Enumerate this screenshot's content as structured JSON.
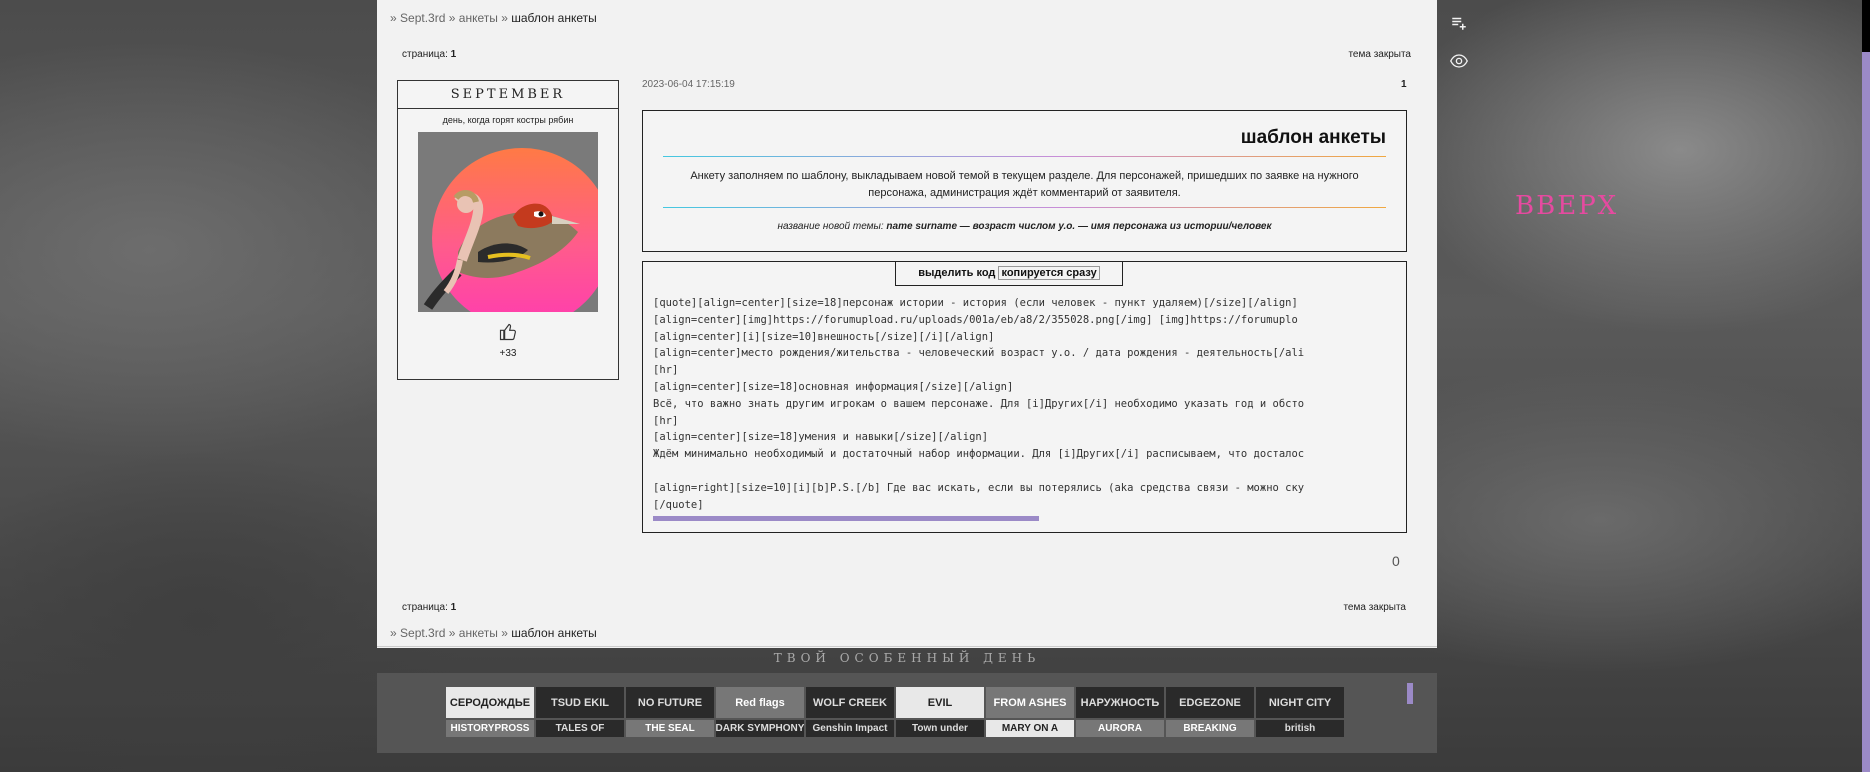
{
  "breadcrumb": {
    "sep": "»",
    "items": [
      "Sept.3rd",
      "анкеты",
      "шаблон анкеты"
    ]
  },
  "pagination": {
    "label": "страница:",
    "page": "1"
  },
  "topic_closed": "тема закрыта",
  "profile": {
    "logo": "SEPTEMBER",
    "status": "день, когда горят костры рябин",
    "likes": "+33"
  },
  "post": {
    "date": "2023-06-04 17:15:19",
    "number": "1",
    "title": "шаблон анкеты",
    "intro": "Анкету заполняем по шаблону, выкладываем новой темой в текущем разделе. Для персонажей, пришедших по заявке на нужного персонажа, администрация ждёт комментарий от заявителя.",
    "topic_note_prefix": "название новой темы:",
    "topic_note_bold": "name surname — возраст числом у.о. — имя персонажа из истории/человек"
  },
  "code_box": {
    "select_label": "выделить код",
    "copy_label": "копируется сразу",
    "lines": [
      "[quote][align=center][size=18]персонаж истории - история (если человек - пункт удаляем)[/size][/align]",
      "[align=center][img]https://forumupload.ru/uploads/001a/eb/a8/2/355028.png[/img] [img]https://forumuplo",
      "[align=center][i][size=10]внешность[/size][/i][/align]",
      "[align=center]место рождения/жительства - человеческий возраст у.о. / дата рождения - деятельность[/ali",
      "[hr]",
      "[align=center][size=18]основная информация[/size][/align]",
      "Всё, что важно знать другим игрокам о вашем персонаже. Для [i]Других[/i] необходимо указать год и обсто",
      "[hr]",
      "[align=center][size=18]умения и навыки[/size][/align]",
      "Ждём минимально необходимый и достаточный набор информации. Для [i]Других[/i] расписываем, что досталос",
      "",
      "[align=right][size=10][i][b]P.S.[/b] Где вас искать, если вы потерялись (aka средства связи - можно ску",
      "[/quote]"
    ]
  },
  "post_counter": "0",
  "footer_tag": "ТВОЙ ОСОБЕННЫЙ ДЕНЬ",
  "up_link": "ВВЕРХ",
  "banners": [
    "СЕРОДОЖДЬЕ",
    "TSUD EKIL",
    "NO FUTURE",
    "Red flags",
    "WOLF CREEK",
    "EVIL",
    "FROM ASHES",
    "НАРУЖНОСТЬ",
    "EDGEZONE",
    "NIGHT CITY",
    "HISTORYPROSS",
    "TALES OF",
    "THE SEAL",
    "DARK SYMPHONY",
    "Genshin Impact",
    "Town under",
    "MARY ON A",
    "AURORA",
    "BREAKING",
    "british"
  ],
  "icons": {
    "side_top": "playlist-add-icon",
    "side_bottom": "eye-icon",
    "like": "thumbs-up-icon"
  }
}
